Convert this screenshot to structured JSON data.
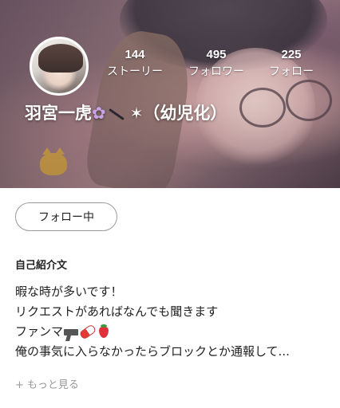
{
  "profile": {
    "name": "羽宮一虎",
    "name_suffix": "（幼児化）",
    "name_star": "✶"
  },
  "stats": [
    {
      "count": "144",
      "label": "ストーリー"
    },
    {
      "count": "495",
      "label": "フォロワー"
    },
    {
      "count": "225",
      "label": "フォロー"
    }
  ],
  "follow_button": {
    "label": "フォロー中"
  },
  "bio": {
    "title": "自己紹介文",
    "lines": [
      "暇な時が多いです！",
      "リクエストがあればなんでも聞きます",
      "ファンマ",
      "俺の事気に入らなかったらブロックとか通報して..."
    ]
  },
  "more": {
    "icon": "plus-icon",
    "label": "もっと見る"
  },
  "icons": {
    "flower": "flower-icon",
    "pen": "pen-icon",
    "fanmark": [
      "gun-icon",
      "pill-icon",
      "strawberry-icon"
    ]
  },
  "colors": {
    "accent_flower": "#c8a3e8",
    "text": "#222222",
    "muted": "#999999",
    "button_border": "#9a9a9a"
  }
}
